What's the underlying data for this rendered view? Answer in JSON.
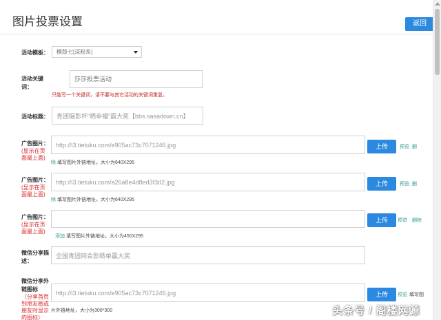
{
  "header": {
    "title": "图片投票设置",
    "back_label": "返回"
  },
  "template": {
    "label": "活动模板：",
    "value": "模版七[深粉系]"
  },
  "keyword": {
    "label": "活动关键词：",
    "placeholder": "莎莎投票活动",
    "warning": "只能写一个关键词，请不要与其它活动的关键词重复。"
  },
  "title_field": {
    "label": "活动标题：",
    "value": "青团摄影杯“晒幸福”赢大奖【bbs.sasadown.cn】"
  },
  "ads": [
    {
      "label": "广告图片：",
      "note": "(显示在页面最上面)",
      "value": "http://i3.tietuku.com/e905ac73c7071246.jpg",
      "upload": "上传",
      "preview": "预览",
      "delete": "删",
      "hint_prefix": "除",
      "hint": "填写图片外链地址，大小为640X295"
    },
    {
      "label": "广告图片：",
      "note": "(显示在页面最上面)",
      "value": "http://i3.tietuku.com/a26a8e4d8ed3f3d2.jpg",
      "upload": "上传",
      "preview": "预览",
      "delete": "删",
      "hint_prefix": "除",
      "hint": "填写图片外链地址，大小为640X295"
    },
    {
      "label": "广告图片：",
      "note": "(显示在页面最上面)",
      "value": "",
      "upload": "上传",
      "preview": "预览",
      "delete": "删除",
      "hint_prefix": "添加",
      "hint": "填写图片外链地址，大小为450X295"
    }
  ],
  "share_desc": {
    "label": "微信分享描述：",
    "value": "全国青团网合影晒单赢大奖"
  },
  "share_icon": {
    "label": "微信分享外链图标",
    "note": "（分享首页到朋友圈或朋友时显示的图标）",
    "value": "http://i3.tietuku.com/e905ac73c7071246.jpg",
    "upload": "上传",
    "preview": "预览",
    "fill": "填写图",
    "hint": "片外链地址，大小为300*300"
  },
  "watermark": "头条号 / 阁楼网源"
}
